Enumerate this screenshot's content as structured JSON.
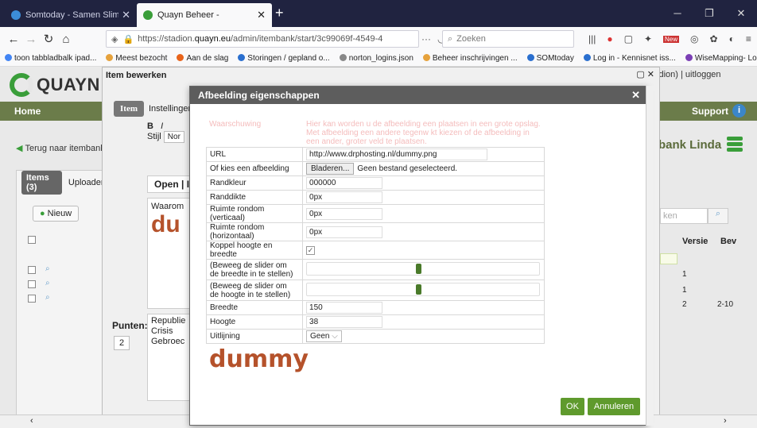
{
  "browser": {
    "tabs": [
      {
        "title": "Somtoday - Samen Slimmer O"
      },
      {
        "title": "Quayn Beheer -"
      }
    ],
    "url": {
      "prefix": "https://stadion.",
      "domain": "quayn.eu",
      "path": "/admin/itembank/start/3c99069f-4549-4"
    },
    "search_placeholder": "Zoeken",
    "bookmarks": [
      "toon tabbladbalk ipad...",
      "Meest bezocht",
      "Aan de slag",
      "Storingen / gepland o...",
      "norton_logins.json",
      "Beheer inschrijvingen ...",
      "SOMtoday",
      "Log in - Kennisnet iss...",
      "WiseMapping- Login"
    ],
    "new_badge": "New"
  },
  "page": {
    "logo": "QUAYN",
    "top_right": "huis - Stadion) | uitloggen",
    "nav_home": "Home",
    "nav_support": "Support",
    "back_link": "Terug naar itembanko",
    "bank_name": "bank Linda",
    "left_tabs": {
      "items": "Items (3)",
      "upload": "Uploaden"
    },
    "new_button": "Nieuw",
    "right_search_placeholder": "ken",
    "col_versie": "Versie",
    "col_bev": "Bev",
    "rows": [
      {
        "versie": "1"
      },
      {
        "versie": "1"
      },
      {
        "versie": "2",
        "bev": "2-10"
      }
    ]
  },
  "inner_window": {
    "title": "Item bewerken",
    "tab_item": "Item",
    "tab_settings": "Instellingen",
    "style_label": "Stijl",
    "style_value": "Nor",
    "open_label": "Open | I",
    "content_word": "Waarom",
    "content_big": "du",
    "points_label": "Punten:",
    "points_value": "2",
    "answer_lines": [
      "Republie",
      "Crisis",
      "Gebroec"
    ]
  },
  "dialog": {
    "title": "Afbeelding eigenschappen",
    "note_label": "Waarschuwing",
    "note_text": "Hier kan worden u de afbeelding een plaatsen in een grote opslag. Met afbeelding een andere tegenw kt kiezen of de afbeelding in een ander, groter veld te plaatsen.",
    "props": {
      "url_label": "URL",
      "url_value": "http://www.drphosting.nl/dummy.png",
      "choose_label": "Of kies een afbeelding",
      "browse_label": "Bladeren...",
      "file_status": "Geen bestand geselecteerd.",
      "border_color_label": "Randkleur",
      "border_color_value": "000000",
      "border_width_label": "Randdikte",
      "border_width_value": "0px",
      "space_v_label": "Ruimte rondom (verticaal)",
      "space_v_value": "0px",
      "space_h_label": "Ruimte rondom (horizontaal)",
      "space_h_value": "0px",
      "link_label": "Koppel hoogte en breedte",
      "link_checked": true,
      "slider_w_label_1": "(Beweeg de slider om",
      "slider_w_label_2": "de breedte in te stellen)",
      "slider_w_value": 0.48,
      "slider_h_label_1": "(Beweeg de slider om",
      "slider_h_label_2": "de hoogte in te stellen)",
      "slider_h_value": 0.48,
      "width_label": "Breedte",
      "width_value": "150",
      "height_label": "Hoogte",
      "height_value": "38",
      "align_label": "Uitlijning",
      "align_value": "Geen"
    },
    "preview_text": "dummy",
    "ok_label": "OK",
    "cancel_label": "Annuleren"
  },
  "colors": {
    "accent_green": "#5f9a2d",
    "nav_green": "#6b7c4a",
    "preview_rust": "#b5522b",
    "dialog_title": "#5d5d5d"
  }
}
